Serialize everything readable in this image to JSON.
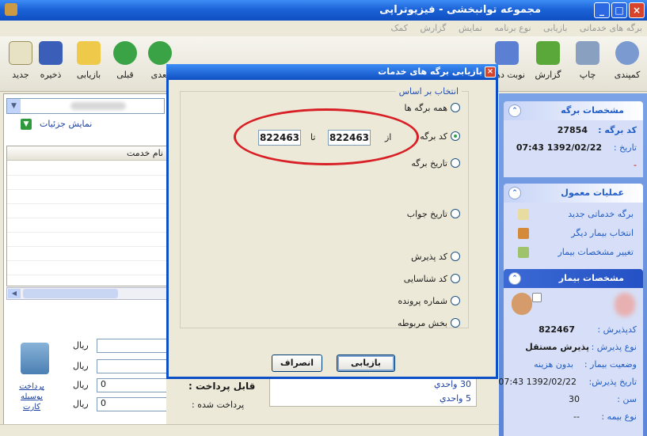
{
  "window": {
    "title": "مجموعه توانبخشی - فیزیوتراپی",
    "buttons": {
      "close": "×",
      "maximize": "□",
      "minimize": "_"
    }
  },
  "menu": [
    "برگه های خدماتی",
    "بازیابی",
    "نوع برنامه",
    "نمایش",
    "گزارش",
    "کمک"
  ],
  "toolbar": [
    {
      "label": "جدید",
      "icon": "new-doc-icon",
      "color": "#e8e2c4"
    },
    {
      "label": "ذخیره",
      "icon": "save-icon",
      "color": "#3b5fb8"
    },
    {
      "label": "بازیابی",
      "icon": "folder-icon",
      "color": "#efc94a"
    },
    {
      "label": "قبلی",
      "icon": "prev-arrow-icon",
      "color": "#3aa346"
    },
    {
      "label": "بعدی",
      "icon": "next-arrow-icon",
      "color": "#3aa346"
    },
    {
      "label": "نوبت دهی",
      "icon": "calendar-icon",
      "color": "#5b7fd2"
    },
    {
      "label": "گزارش",
      "icon": "chart-icon",
      "color": "#5aa83a"
    },
    {
      "label": "چاپ",
      "icon": "printer-icon",
      "color": "#8aa0c0"
    },
    {
      "label": "کمپندی",
      "icon": "gear-icon",
      "color": "#7a9ad0"
    }
  ],
  "left": {
    "details_link": "نمایش جزئیات",
    "details_icon": "▼",
    "grid_header": "نام خدمت",
    "currency": "ریال",
    "payable_label": "قابل پرداخت :",
    "payable_value": "0",
    "paid_label": "پرداخت شده :",
    "paid_value": "0",
    "card_link": "پرداخت بوسیله کارت",
    "units": [
      "30 واحدي",
      "5 واحدي"
    ]
  },
  "dialog": {
    "title": "بازیابی برگه های خدمات",
    "close": "×",
    "group_label": "انتخاب بر اساس",
    "options": [
      {
        "label": "همه برگه ها",
        "selected": false
      },
      {
        "label": "کد برگه",
        "selected": true
      },
      {
        "label": "تاریخ برگه",
        "selected": false
      },
      {
        "label": "تاریخ جواب",
        "selected": false
      },
      {
        "label": "کد پذیرش",
        "selected": false
      },
      {
        "label": "کد شناسایی",
        "selected": false
      },
      {
        "label": "شماره پرونده",
        "selected": false
      },
      {
        "label": "بخش مربوطه",
        "selected": false
      }
    ],
    "from_label": "از",
    "to_label": "تا",
    "from_value": "822463",
    "to_value": "822463",
    "search_button": "بازیابی",
    "cancel_button": "انصراف",
    "highlight_color": "#d81f26"
  },
  "right": {
    "sheet_panel": {
      "title": "مشخصات برگه",
      "code_label": "کد برگه :",
      "code_value": "27854",
      "date_label": "تاریخ :",
      "date_value": "1392/02/22 07:43",
      "extra": "-"
    },
    "ops_panel": {
      "title": "عملیات معمول",
      "items": [
        "برگه خدماتی جدید",
        "انتخاب بیمار دیگر",
        "تغییر مشخصات بیمار"
      ]
    },
    "patient_panel": {
      "title": "مشخصات بیمار",
      "admission_label": "کدپذیرش :",
      "admission_value": "822467",
      "type_label": "نوع پذیرش :",
      "type_value": "پذیرش مستقل",
      "status_label": "وضعیت بیمار :",
      "status_value": "بدون هزینه",
      "adm_date_label": "تاریخ پذیرش:",
      "adm_date_value": "1392/02/22 07:43",
      "age_label": "سن :",
      "age_value": "30",
      "insurance_label": "نوع بیمه :",
      "insurance_value": "--"
    },
    "collapse": "⌃"
  }
}
